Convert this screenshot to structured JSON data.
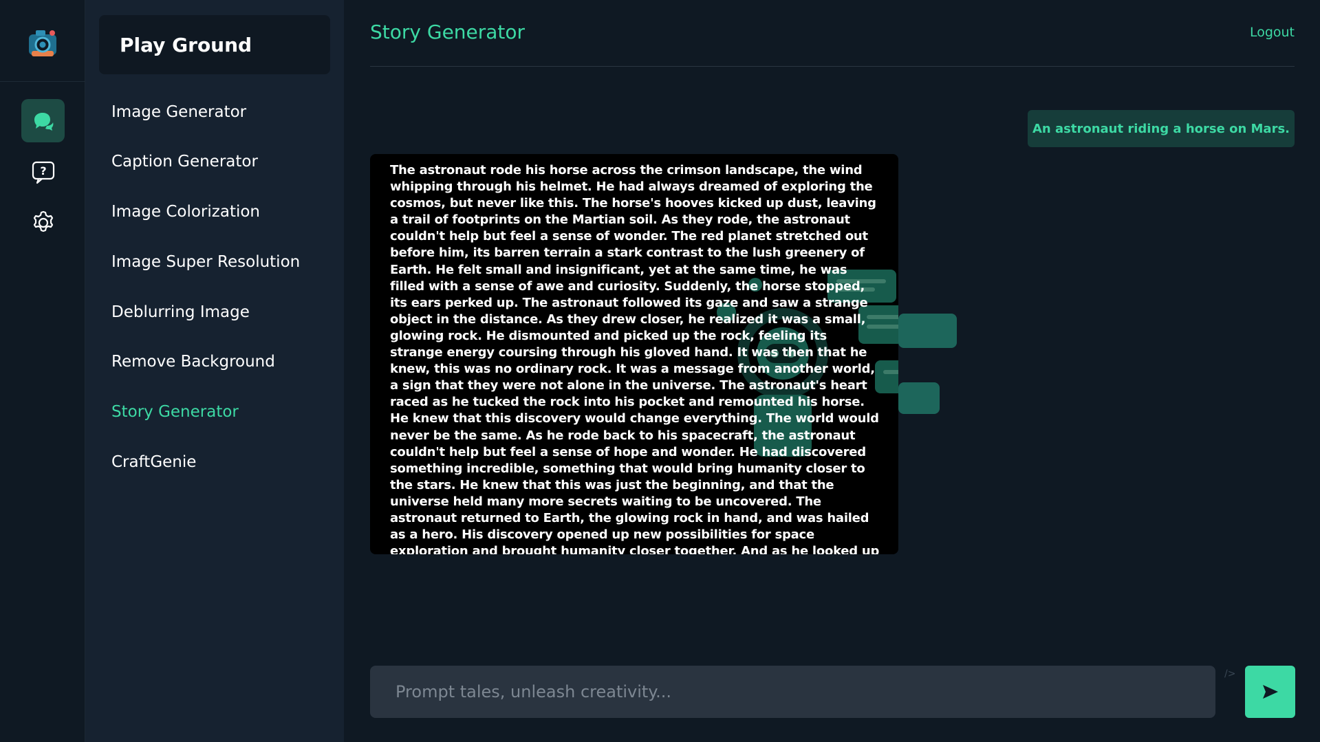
{
  "rail": {
    "logo_icon": "camera-logo-icon",
    "items": [
      {
        "icon": "chat-bubbles-icon",
        "active": true
      },
      {
        "icon": "help-question-icon",
        "active": false
      },
      {
        "icon": "settings-gear-icon",
        "active": false
      }
    ]
  },
  "nav": {
    "header": "Play Ground",
    "items": [
      {
        "label": "Image Generator"
      },
      {
        "label": "Caption Generator"
      },
      {
        "label": "Image Colorization"
      },
      {
        "label": "Image Super Resolution"
      },
      {
        "label": "Deblurring Image"
      },
      {
        "label": "Remove Background"
      },
      {
        "label": "Story Generator",
        "active": true
      },
      {
        "label": "CraftGenie"
      }
    ]
  },
  "main": {
    "title": "Story Generator",
    "logout": "Logout",
    "user_prompt": "An astronaut riding a horse on Mars.",
    "story": "The astronaut rode his horse across the crimson landscape, the wind whipping through his helmet. He had always dreamed of exploring the cosmos, but never like this. The horse's hooves kicked up dust, leaving a trail of footprints on the Martian soil. As they rode, the astronaut couldn't help but feel a sense of wonder. The red planet stretched out before him, its barren terrain a stark contrast to the lush greenery of Earth. He felt small and insignificant, yet at the same time, he was filled with a sense of awe and curiosity. Suddenly, the horse stopped, its ears perked up. The astronaut followed its gaze and saw a strange object in the distance. As they drew closer, he realized it was a small, glowing rock. He dismounted and picked up the rock, feeling its strange energy coursing through his gloved hand. It was then that he knew, this was no ordinary rock. It was a message from another world, a sign that they were not alone in the universe. The astronaut's heart raced as he tucked the rock into his pocket and remounted his horse. He knew that this discovery would change everything. The world would never be the same. As he rode back to his spacecraft, the astronaut couldn't help but feel a sense of hope and wonder. He had discovered something incredible, something that would bring humanity closer to the stars. He knew that this was just the beginning, and that the universe held many more secrets waiting to be uncovered. The astronaut returned to Earth, the glowing rock in hand, and was hailed as a hero. His discovery opened up new possibilities for space exploration and brought humanity closer together. And as he looked up at the stars, he knew that there was no limit to what they could achieve.",
    "input_placeholder": "Prompt tales, unleash creativity...",
    "slash_hint": "/>",
    "send_icon": "send-arrow-icon"
  },
  "colors": {
    "accent": "#3dd9a4",
    "bg": "#0f1923",
    "nav_bg": "#162230",
    "input_bg": "#2a3440",
    "bubble_bg": "#163d3a"
  }
}
